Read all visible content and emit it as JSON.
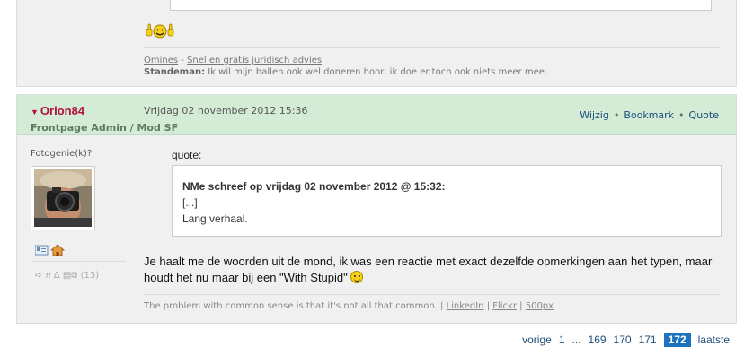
{
  "prev_post": {
    "smiley": "thumbs-up-smiley",
    "sig_link1": "Omines",
    "sig_dash": "-",
    "sig_link2": "Snel en gratis juridisch advies",
    "sig_user": "Standeman:",
    "sig_text": "Ik wil mijn ballen ook wel doneren hoor, ik doe er toch ook niets meer mee."
  },
  "post": {
    "username": "Orion84",
    "date": "Vrijdag 02 november 2012 15:36",
    "usertitle": "Frontpage Admin / Mod SF",
    "actions": {
      "edit": "Wijzig",
      "bookmark": "Bookmark",
      "quote": "Quote",
      "sep": "•"
    },
    "user_subtitle": "Fotogenie(k)?",
    "icon_count": "(13)",
    "quote_label": "quote:",
    "quote_header": "NMe schreef op vrijdag 02 november 2012 @ 15:32:",
    "quote_line1": "[...]",
    "quote_line2": "Lang verhaal.",
    "message": "Je haalt me de woorden uit de mond, ik was een reactie met exact dezelfde opmerkingen aan het typen, maar houdt het nu maar bij een \"With Stupid\"",
    "sig_text": "The problem with common sense is that it's not all that common. |",
    "sig_link1": "LinkedIn",
    "sig_bar1": "|",
    "sig_link2": "Flickr",
    "sig_bar2": "|",
    "sig_link3": "500px"
  },
  "pagination": {
    "prev": "vorige",
    "first": "1",
    "ellipsis": "...",
    "p169": "169",
    "p170": "170",
    "p171": "171",
    "current": "172",
    "last": "laatste"
  },
  "colors": {
    "username": "#b0103a",
    "header_bg": "#d4ecd6",
    "current_page": "#1e73be"
  }
}
